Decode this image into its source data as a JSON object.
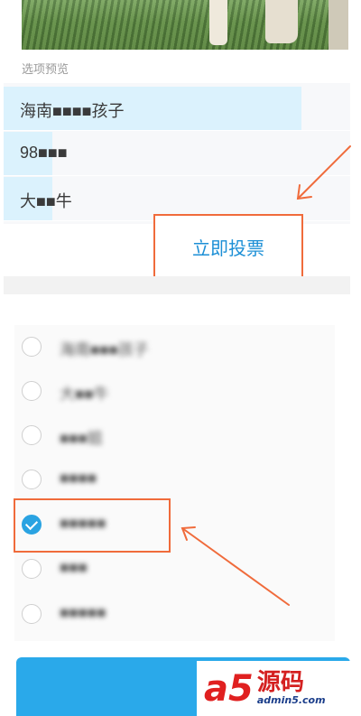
{
  "section_title": "选项预览",
  "preview_options": [
    {
      "label": "海南■■■■孩子",
      "fill": 0.86
    },
    {
      "label": "98■■■",
      "fill": 0.14
    },
    {
      "label": "大■■牛",
      "fill": 0.14
    }
  ],
  "vote_button": "立即投票",
  "options": [
    {
      "label": "海南■■■孩子",
      "selected": false
    },
    {
      "label": "大■■牛",
      "selected": false
    },
    {
      "label": "■■■姐",
      "selected": false
    },
    {
      "label": "■■■■",
      "selected": false
    },
    {
      "label": "■■■■■",
      "selected": true
    },
    {
      "label": "■■■",
      "selected": false
    },
    {
      "label": "■■■■■",
      "selected": false
    }
  ],
  "watermark": {
    "brand": "a5",
    "cn": "源码",
    "url": "admin5.com"
  },
  "colors": {
    "accent": "#2aa3e2",
    "annotation": "#f06b3b",
    "preview_fill": "#dbf2fd"
  }
}
